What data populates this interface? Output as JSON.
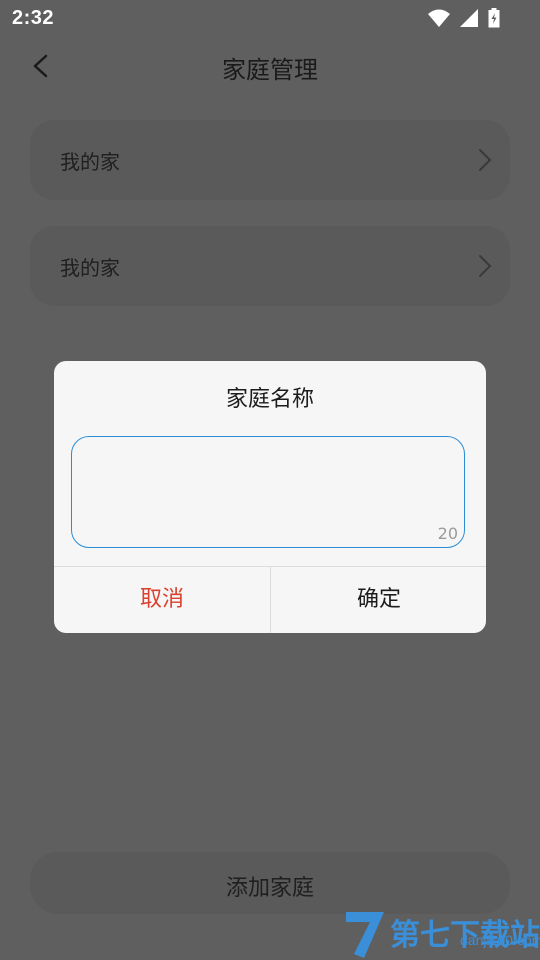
{
  "status_bar": {
    "time": "2:32"
  },
  "header": {
    "title": "家庭管理"
  },
  "family_list": [
    {
      "name": "我的家"
    },
    {
      "name": "我的家"
    }
  ],
  "dialog": {
    "title": "家庭名称",
    "input_value": "",
    "char_limit": "20",
    "cancel_label": "取消",
    "confirm_label": "确定"
  },
  "footer": {
    "add_label": "添加家庭"
  },
  "watermark": {
    "text": "第七下载站",
    "url": "danji100.com"
  },
  "colors": {
    "accent": "#2a8ed6",
    "cancel": "#d9412e"
  }
}
